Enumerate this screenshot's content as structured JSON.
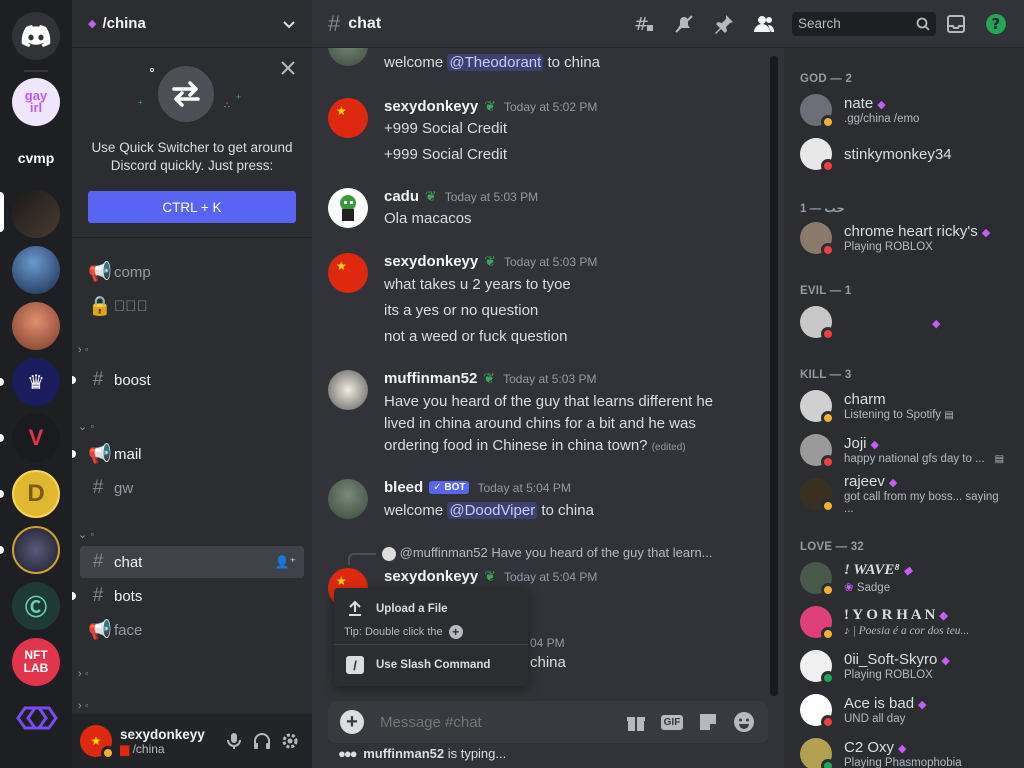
{
  "rail": {
    "servers": [
      {
        "label": "",
        "bg": "#5865f2",
        "kind": "home"
      },
      {
        "label": "gay irl",
        "bg": "#f0e7ff"
      },
      {
        "label": "cvmp",
        "bg": "#1e1f22"
      },
      {
        "label": "",
        "bg": "#3a2a2a"
      },
      {
        "label": "",
        "bg": "#2c4a6a"
      },
      {
        "label": "",
        "bg": "#c96a4e"
      },
      {
        "label": "",
        "bg": "#1a1d5e"
      },
      {
        "label": "",
        "bg": "#1a1b1e"
      },
      {
        "label": "D",
        "bg": "#e0b830"
      },
      {
        "label": "",
        "bg": "#2a2a3a"
      },
      {
        "label": "C",
        "bg": "#1f3a36"
      },
      {
        "label": "NFT LAB",
        "bg": "#e0354a"
      },
      {
        "label": "",
        "bg": "#1e1f22"
      }
    ]
  },
  "sidebar": {
    "guild_name": "/china",
    "quick_switcher": {
      "text_line1": "Use Quick Switcher to get around",
      "text_line2": "Discord quickly. Just press:",
      "button": "CTRL + K"
    },
    "channels": [
      {
        "name": "comp",
        "type": "announce"
      },
      {
        "name": "\u0000\u0000\u0000",
        "type": "locked"
      },
      {
        "name": "boost",
        "type": "text"
      },
      {
        "name": "mail",
        "type": "announce"
      },
      {
        "name": "gw",
        "type": "text"
      },
      {
        "name": "chat",
        "type": "text"
      },
      {
        "name": "bots",
        "type": "text"
      },
      {
        "name": "face",
        "type": "announce"
      }
    ],
    "user": {
      "name": "sexydonkeyy",
      "sub": "/china"
    }
  },
  "header": {
    "channel": "chat",
    "search_placeholder": "Search"
  },
  "messages": {
    "m0_text": "welcome",
    "m0_mention": "@Theodorant",
    "m0_tail": "to china",
    "m1_author": "sexydonkeyy",
    "m1_time": "Today at 5:02 PM",
    "m1_l1": "+999 Social Credit",
    "m1_l2": "+999 Social Credit",
    "m2_author": "cadu",
    "m2_time": "Today at 5:03 PM",
    "m2_l1": "Ola macacos",
    "m3_author": "sexydonkeyy",
    "m3_time": "Today at 5:03 PM",
    "m3_l1": "what takes u 2 years to tyoe",
    "m3_l2": "its a yes or no question",
    "m3_l3": "not a weed or fuck question",
    "m4_author": "muffinman52",
    "m4_time": "Today at 5:03 PM",
    "m4_l1": "Have you heard of the guy that learns different he",
    "m4_l2": "lived in china around chins for a bit and he was",
    "m4_l3": "ordering food in Chinese in china town?",
    "m4_edited": "(edited)",
    "m5_author": "bleed",
    "m5_bot": "✓ BOT",
    "m5_time": "Today at 5:04 PM",
    "m5_text": "welcome",
    "m5_mention": "@DoodViper",
    "m5_tail": "to china",
    "m6_reply_user": "@muffinman52",
    "m6_reply_text": "Have you heard of the guy that learn...",
    "m6_author": "sexydonkeyy",
    "m6_time": "Today at 5:04 PM",
    "m7_time_partial": "04 PM",
    "m7_text_partial": "china"
  },
  "popup": {
    "upload": "Upload a File",
    "tip": "Tip: Double click the",
    "slash": "Use Slash Command"
  },
  "composer": {
    "placeholder": "Message #chat",
    "typing_user": "muffinman52",
    "typing_tail": " is typing..."
  },
  "members": {
    "cats": [
      "GOD — 2",
      "حب — 1",
      "EVIL — 1",
      "KILL — 3",
      "LOVE — 32"
    ],
    "list": [
      {
        "name": "nate",
        "sub": ".gg/china /emo",
        "status": "#f0b232",
        "av": "#6d6f78"
      },
      {
        "name": "stinkymonkey34",
        "sub": "",
        "status": "#f23f43",
        "av": "#e8e8e8"
      },
      {
        "name": "chrome heart ricky's",
        "sub": "Playing ROBLOX",
        "status": "#f23f43",
        "av": "#8a7a6a"
      },
      {
        "name": "",
        "sub": "",
        "status": "#f23f43",
        "av": "#c8c8c8"
      },
      {
        "name": "charm",
        "sub": "Listening to Spotify",
        "status": "#f0b232",
        "av": "#d0d0d0"
      },
      {
        "name": "Joji",
        "sub": "happy national gfs day to ...",
        "status": "#f23f43",
        "av": "#9a9a9a"
      },
      {
        "name": "rajeev",
        "sub": "got call from my boss... saying ...",
        "status": "#f0b232",
        "av": "#3a3020"
      },
      {
        "name": "! WAVE⁸",
        "sub": "Sadge",
        "status": "#f0b232",
        "av": "#4a5a4a"
      },
      {
        "name": "! Y O R H A N",
        "sub": "| Poesia é a cor dos teu...",
        "status": "#f0b232",
        "av": "#e0407a"
      },
      {
        "name": "0ii_Soft-Skyro",
        "sub": "Playing ROBLOX",
        "status": "#23a55a",
        "av": "#f0f0f0"
      },
      {
        "name": "Ace is bad",
        "sub": "UND all day",
        "status": "#f23f43",
        "av": "#ffffff"
      },
      {
        "name": "C2 Oxy",
        "sub": "Playing Phasmophobia",
        "status": "#23a55a",
        "av": "#b0a050"
      }
    ]
  }
}
